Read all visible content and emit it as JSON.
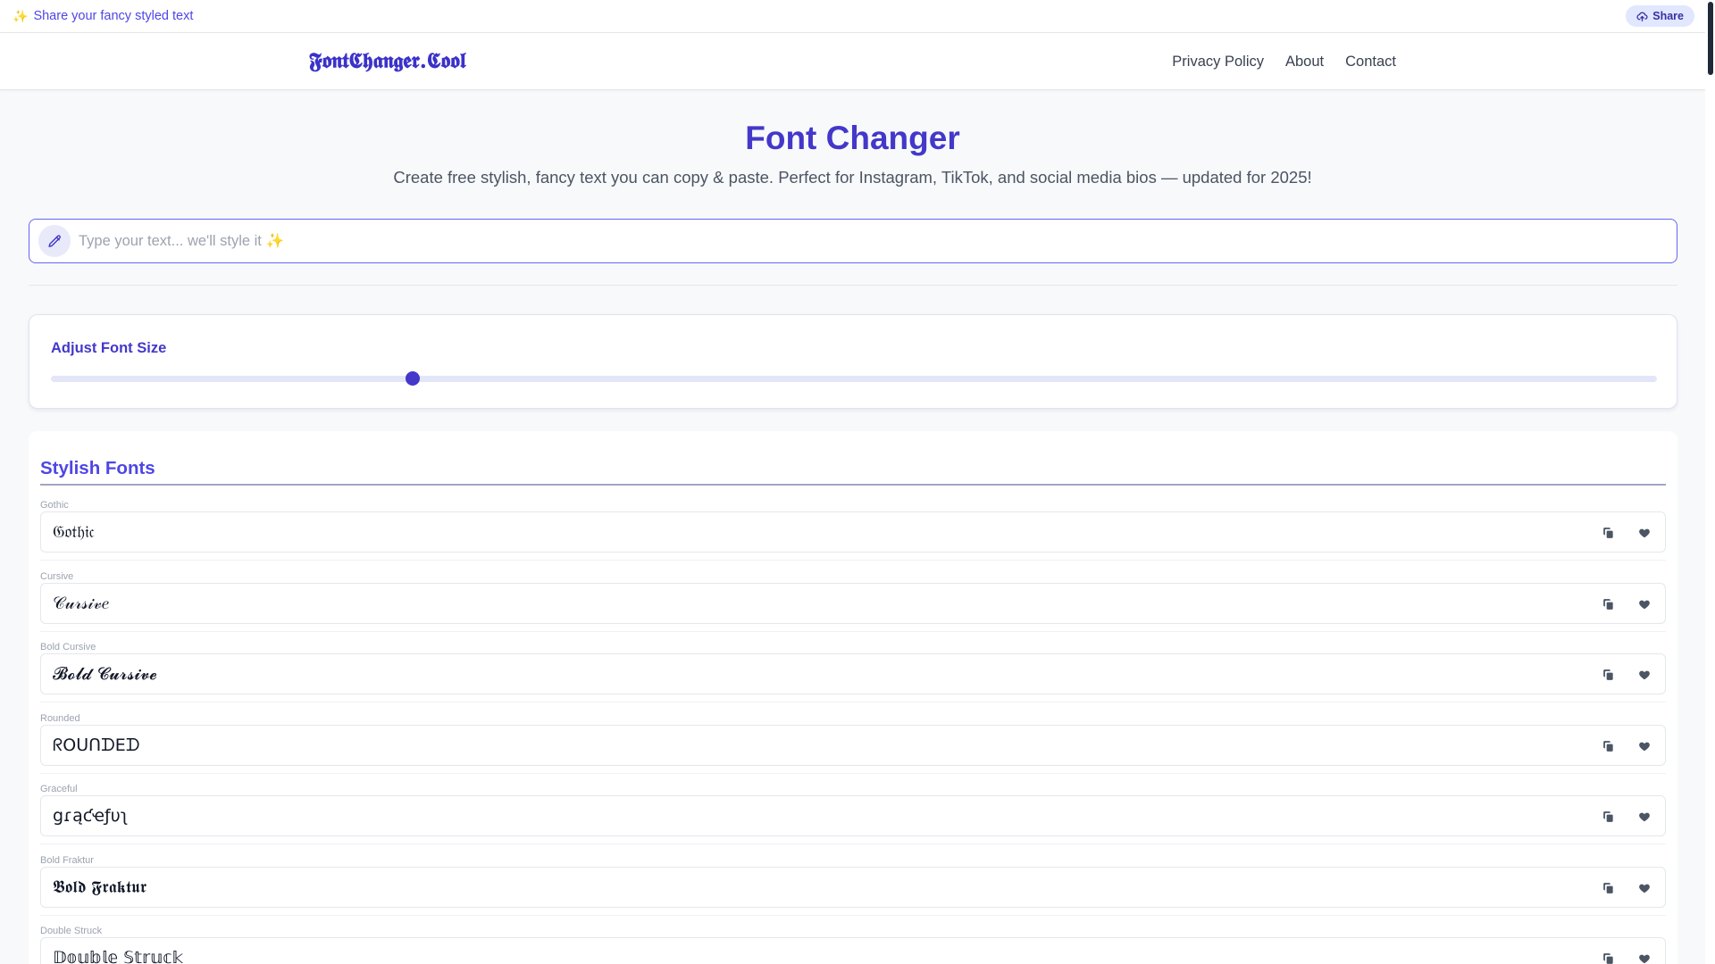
{
  "topbar": {
    "message": "Share your fancy styled text",
    "share_label": "Share"
  },
  "nav": {
    "logo": "𝕱𝖔𝖓𝖙𝕮𝖍𝖆𝖓𝖌𝖊𝖗.𝕮𝖔𝖔𝖑",
    "links": [
      "Privacy Policy",
      "About",
      "Contact"
    ]
  },
  "hero": {
    "title": "Font Changer",
    "subtitle": "Create free stylish, fancy text you can copy & paste. Perfect for Instagram, TikTok, and social media bios — updated for 2025!"
  },
  "input": {
    "placeholder": "Type your text... we'll style it ✨",
    "value": ""
  },
  "font_size": {
    "label": "Adjust Font Size",
    "value_fraction": 0.225
  },
  "fonts_section": {
    "heading": "Stylish Fonts",
    "items": [
      {
        "label": "Gothic",
        "sample": "𝔊𝔬𝔱𝔥𝔦𝔠"
      },
      {
        "label": "Cursive",
        "sample": "𝒞𝓊𝓇𝓈𝒾𝓋𝑒"
      },
      {
        "label": "Bold Cursive",
        "sample": "𝓑𝓸𝓵𝓭 𝓒𝓾𝓻𝓼𝓲𝓿𝓮"
      },
      {
        "label": "Rounded",
        "sample": "ᖇOᑌᑎᗪEᗪ"
      },
      {
        "label": "Graceful",
        "sample": "ցɾąƈҽƒυʅ"
      },
      {
        "label": "Bold Fraktur",
        "sample": "𝕭𝖔𝖑𝖉 𝕱𝖗𝖆𝖐𝖙𝖚𝖗"
      },
      {
        "label": "Double Struck",
        "sample": "𝔻𝕠𝕦𝕓𝕝𝕖 𝕊𝕥𝕣𝕦𝕔𝕜"
      }
    ]
  },
  "colors": {
    "accent": "#4338ca",
    "accent_light": "#e0e7ff",
    "sparkle": "#f5c518"
  },
  "icons": {
    "topbar": "sparkle-icon",
    "share": "cloud-upload-icon",
    "input": "pencil-icon",
    "copy": "copy-icon",
    "favorite": "heart-icon"
  }
}
